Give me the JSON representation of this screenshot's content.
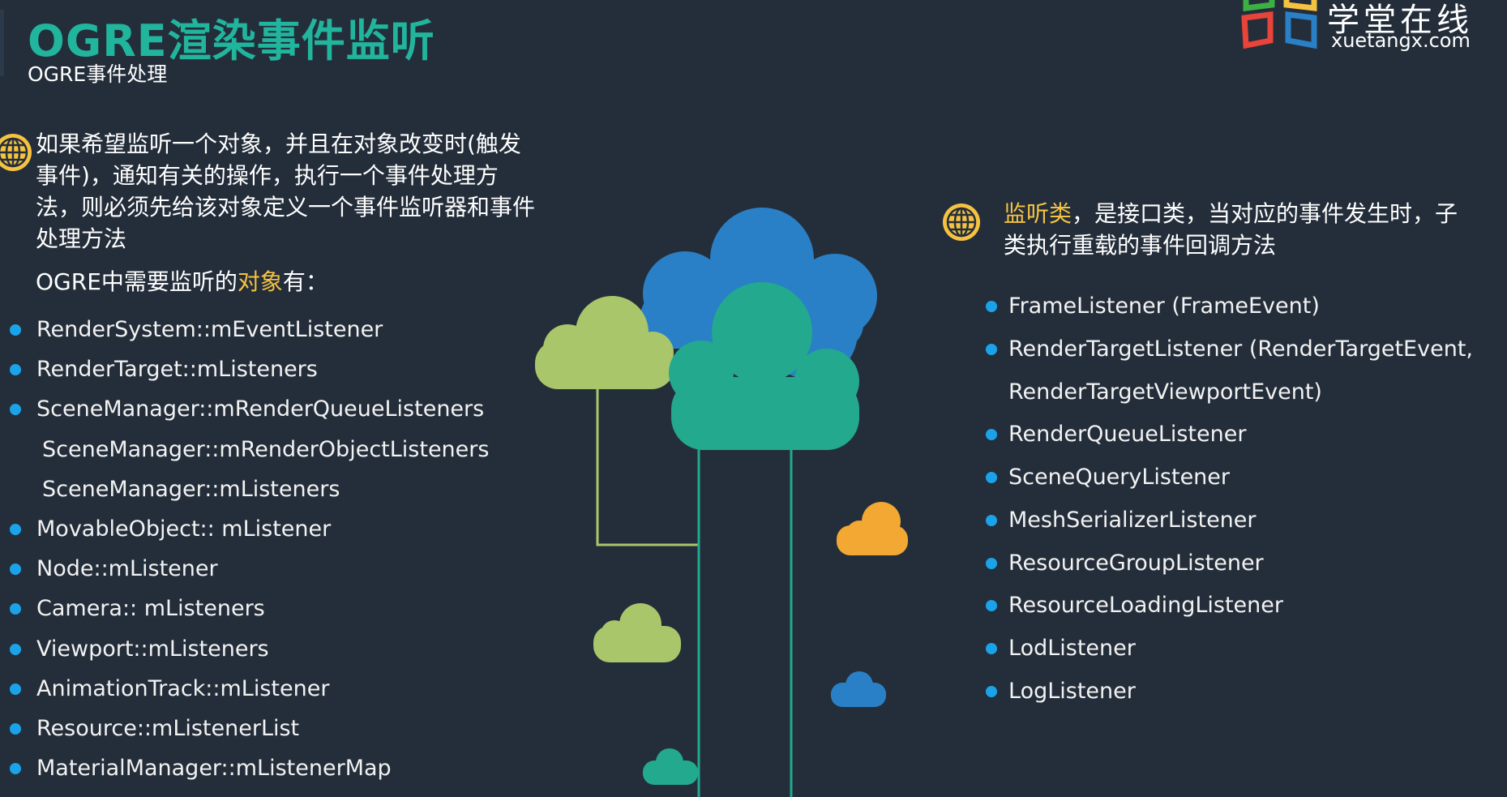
{
  "header": {
    "title": "OGRE渲染事件监听",
    "subtitle": "OGRE事件处理"
  },
  "logo": {
    "name_cn": "学堂在线",
    "name_en": "xuetangx.com",
    "icon": "xuetangx-logo-icon"
  },
  "left": {
    "icon": "globe-icon",
    "paragraph": "如果希望监听一个对象，并且在对象改变时(触发事件)，通知有关的操作，执行一个事件处理方法，则必须先给该对象定义一个事件监听器和事件处理方法",
    "objects_prefix": "OGRE中需要监听的",
    "objects_highlight": "对象",
    "objects_suffix": "有：",
    "items": [
      {
        "text": "RenderSystem::mEventListener",
        "bullet": true
      },
      {
        "text": "RenderTarget::mListeners",
        "bullet": true
      },
      {
        "text": "SceneManager::mRenderQueueListeners",
        "bullet": true
      },
      {
        "text": "SceneManager::mRenderObjectListeners",
        "bullet": false
      },
      {
        "text": "SceneManager::mListeners",
        "bullet": false
      },
      {
        "text": "MovableObject:: mListener",
        "bullet": true
      },
      {
        "text": "Node::mListener",
        "bullet": true
      },
      {
        "text": "Camera:: mListeners",
        "bullet": true
      },
      {
        "text": "Viewport::mListeners",
        "bullet": true
      },
      {
        "text": "AnimationTrack::mListener",
        "bullet": true
      },
      {
        "text": "Resource::mListenerList",
        "bullet": true
      },
      {
        "text": "MaterialManager::mListenerMap",
        "bullet": true
      }
    ]
  },
  "right": {
    "icon": "globe-icon",
    "para_highlight": "监听类",
    "para_rest": "，是接口类，当对应的事件发生时，子类执行重载的事件回调方法",
    "items": [
      {
        "text": "FrameListener (FrameEvent)",
        "bullet": true
      },
      {
        "text": "RenderTargetListener (RenderTargetEvent,",
        "bullet": true
      },
      {
        "text": "RenderTargetViewportEvent)",
        "bullet": false
      },
      {
        "text": "RenderQueueListener",
        "bullet": true
      },
      {
        "text": "SceneQueryListener",
        "bullet": true
      },
      {
        "text": "MeshSerializerListener",
        "bullet": true
      },
      {
        "text": "ResourceGroupListener",
        "bullet": true
      },
      {
        "text": "ResourceLoadingListener",
        "bullet": true
      },
      {
        "text": "LodListener",
        "bullet": true
      },
      {
        "text": "LogListener",
        "bullet": true
      }
    ]
  },
  "colors": {
    "background": "#242e3a",
    "title": "#21b59d",
    "highlight": "#f5c242",
    "bullet": "#1aa3e8",
    "cloud_blue": "#2a80c6",
    "cloud_teal": "#22a98e",
    "cloud_lime": "#a9c66b",
    "cloud_orange": "#f2a833"
  }
}
